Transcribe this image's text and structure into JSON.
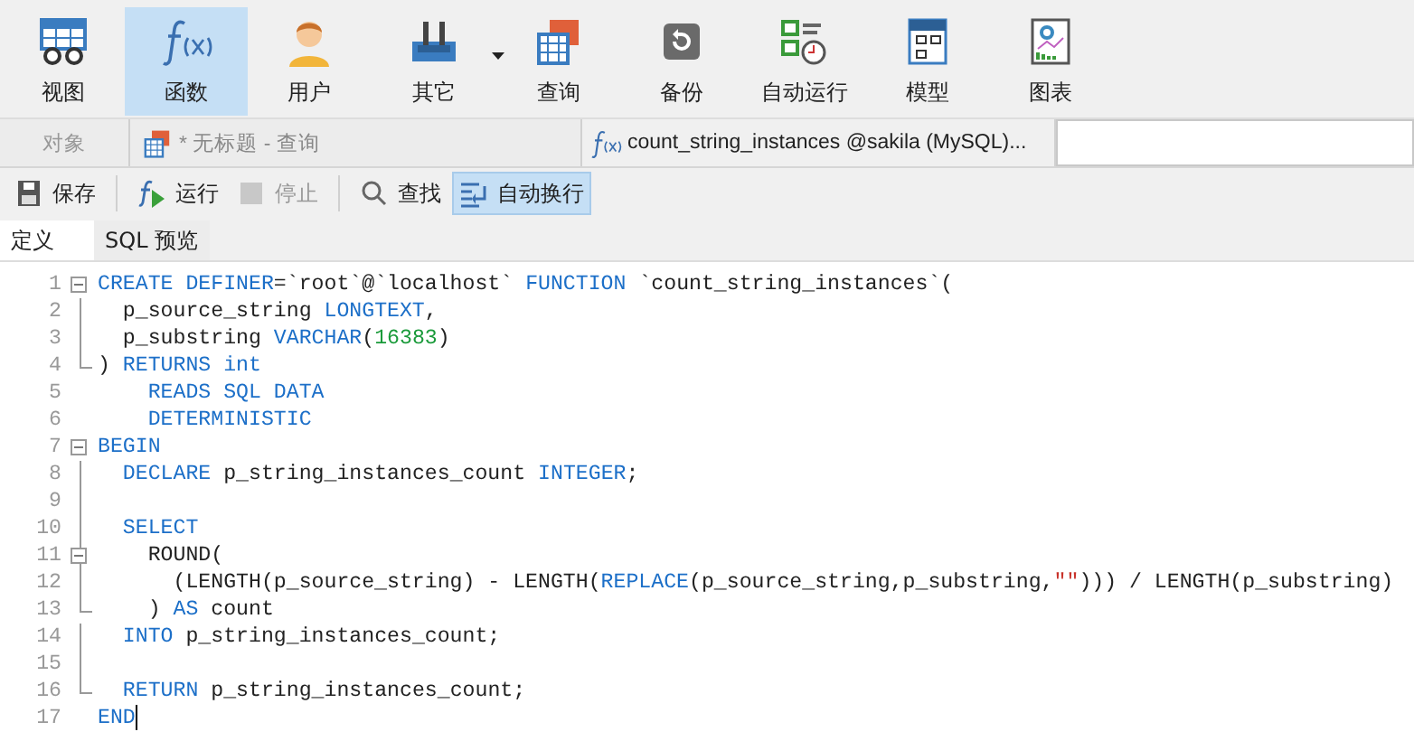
{
  "ribbon": [
    {
      "label": "视图",
      "kind": "view",
      "selected": false
    },
    {
      "label": "函数",
      "kind": "function",
      "selected": true
    },
    {
      "label": "用户",
      "kind": "user",
      "selected": false
    },
    {
      "label": "其它",
      "kind": "tools",
      "selected": false,
      "dropdown": true
    },
    {
      "label": "查询",
      "kind": "query",
      "selected": false
    },
    {
      "label": "备份",
      "kind": "backup",
      "selected": false
    },
    {
      "label": "自动运行",
      "kind": "schedule",
      "selected": false
    },
    {
      "label": "模型",
      "kind": "model",
      "selected": false
    },
    {
      "label": "图表",
      "kind": "chart",
      "selected": false
    }
  ],
  "tabs": [
    {
      "label": "对象",
      "kind": "objects",
      "selected": false
    },
    {
      "label": "* 无标题 - 查询",
      "kind": "query",
      "selected": false
    },
    {
      "label": "count_string_instances @sakila (MySQL)...",
      "kind": "function",
      "selected": true
    }
  ],
  "actions": [
    {
      "kind": "save",
      "label": "保存",
      "disabled": false,
      "on": false
    },
    {
      "kind": "separator"
    },
    {
      "kind": "run",
      "label": "运行",
      "disabled": false,
      "on": false
    },
    {
      "kind": "stop",
      "label": "停止",
      "disabled": true,
      "on": false
    },
    {
      "kind": "separator"
    },
    {
      "kind": "search",
      "label": "查找",
      "disabled": false,
      "on": false
    },
    {
      "kind": "wrap",
      "label": "自动换行",
      "disabled": false,
      "on": true
    }
  ],
  "subtabs": [
    {
      "label": "定义",
      "selected": true
    },
    {
      "label": "SQL 预览",
      "selected": false
    }
  ],
  "editor": {
    "lines": [
      {
        "number": "1",
        "kind": "fold-start",
        "tokens": [
          {
            "kind": "kw",
            "text": "CREATE DEFINER"
          },
          {
            "kind": "plain",
            "text": "=`root`@`localhost` "
          },
          {
            "kind": "kw",
            "text": "FUNCTION"
          },
          {
            "kind": "plain",
            "text": " `count_string_instances`("
          }
        ]
      },
      {
        "number": "2",
        "kind": "fold-line",
        "tokens": [
          {
            "kind": "plain",
            "text": "  p_source_string "
          },
          {
            "kind": "kw",
            "text": "LONGTEXT"
          },
          {
            "kind": "plain",
            "text": ","
          }
        ]
      },
      {
        "number": "3",
        "kind": "fold-line",
        "tokens": [
          {
            "kind": "plain",
            "text": "  p_substring "
          },
          {
            "kind": "kw",
            "text": "VARCHAR"
          },
          {
            "kind": "plain",
            "text": "("
          },
          {
            "kind": "num",
            "text": "16383"
          },
          {
            "kind": "plain",
            "text": ")"
          }
        ]
      },
      {
        "number": "4",
        "kind": "fold-end",
        "tokens": [
          {
            "kind": "plain",
            "text": ") "
          },
          {
            "kind": "kw",
            "text": "RETURNS int"
          }
        ]
      },
      {
        "number": "5",
        "kind": "plain",
        "tokens": [
          {
            "kind": "kw",
            "text": "    READS SQL DATA"
          }
        ]
      },
      {
        "number": "6",
        "kind": "plain",
        "tokens": [
          {
            "kind": "kw",
            "text": "    DETERMINISTIC"
          }
        ]
      },
      {
        "number": "7",
        "kind": "fold-start",
        "tokens": [
          {
            "kind": "kw",
            "text": "BEGIN"
          }
        ]
      },
      {
        "number": "8",
        "kind": "fold-line",
        "tokens": [
          {
            "kind": "kw",
            "text": "  DECLARE"
          },
          {
            "kind": "plain",
            "text": " p_string_instances_count "
          },
          {
            "kind": "kw",
            "text": "INTEGER"
          },
          {
            "kind": "plain",
            "text": ";"
          }
        ]
      },
      {
        "number": "9",
        "kind": "fold-line"
      },
      {
        "number": "10",
        "kind": "fold-line",
        "tokens": [
          {
            "kind": "kw",
            "text": "  SELECT"
          }
        ]
      },
      {
        "number": "11",
        "kind": "fold-start",
        "tokens": [
          {
            "kind": "plain",
            "text": "    ROUND("
          }
        ]
      },
      {
        "number": "12",
        "kind": "fold-line",
        "tokens": [
          {
            "kind": "plain",
            "text": "      (LENGTH(p_source_string) - LENGTH("
          },
          {
            "kind": "kw",
            "text": "REPLACE"
          },
          {
            "kind": "plain",
            "text": "(p_source_string,p_substring,"
          },
          {
            "kind": "str",
            "text": "\"\""
          },
          {
            "kind": "plain",
            "text": "))) / LENGTH(p_substring)"
          }
        ]
      },
      {
        "number": "13",
        "kind": "fold-end",
        "tokens": [
          {
            "kind": "plain",
            "text": "    ) "
          },
          {
            "kind": "kw",
            "text": "AS"
          },
          {
            "kind": "plain",
            "text": " count"
          }
        ]
      },
      {
        "number": "14",
        "kind": "fold-line",
        "tokens": [
          {
            "kind": "kw",
            "text": "  INTO"
          },
          {
            "kind": "plain",
            "text": " p_string_instances_count;"
          }
        ]
      },
      {
        "number": "15",
        "kind": "fold-line"
      },
      {
        "number": "16",
        "kind": "fold-end",
        "tokens": [
          {
            "kind": "kw",
            "text": "  RETURN"
          },
          {
            "kind": "plain",
            "text": " p_string_instances_count;"
          }
        ]
      },
      {
        "number": "17",
        "kind": "plain",
        "tokens": [
          {
            "kind": "kw",
            "text": "END"
          }
        ]
      }
    ]
  }
}
